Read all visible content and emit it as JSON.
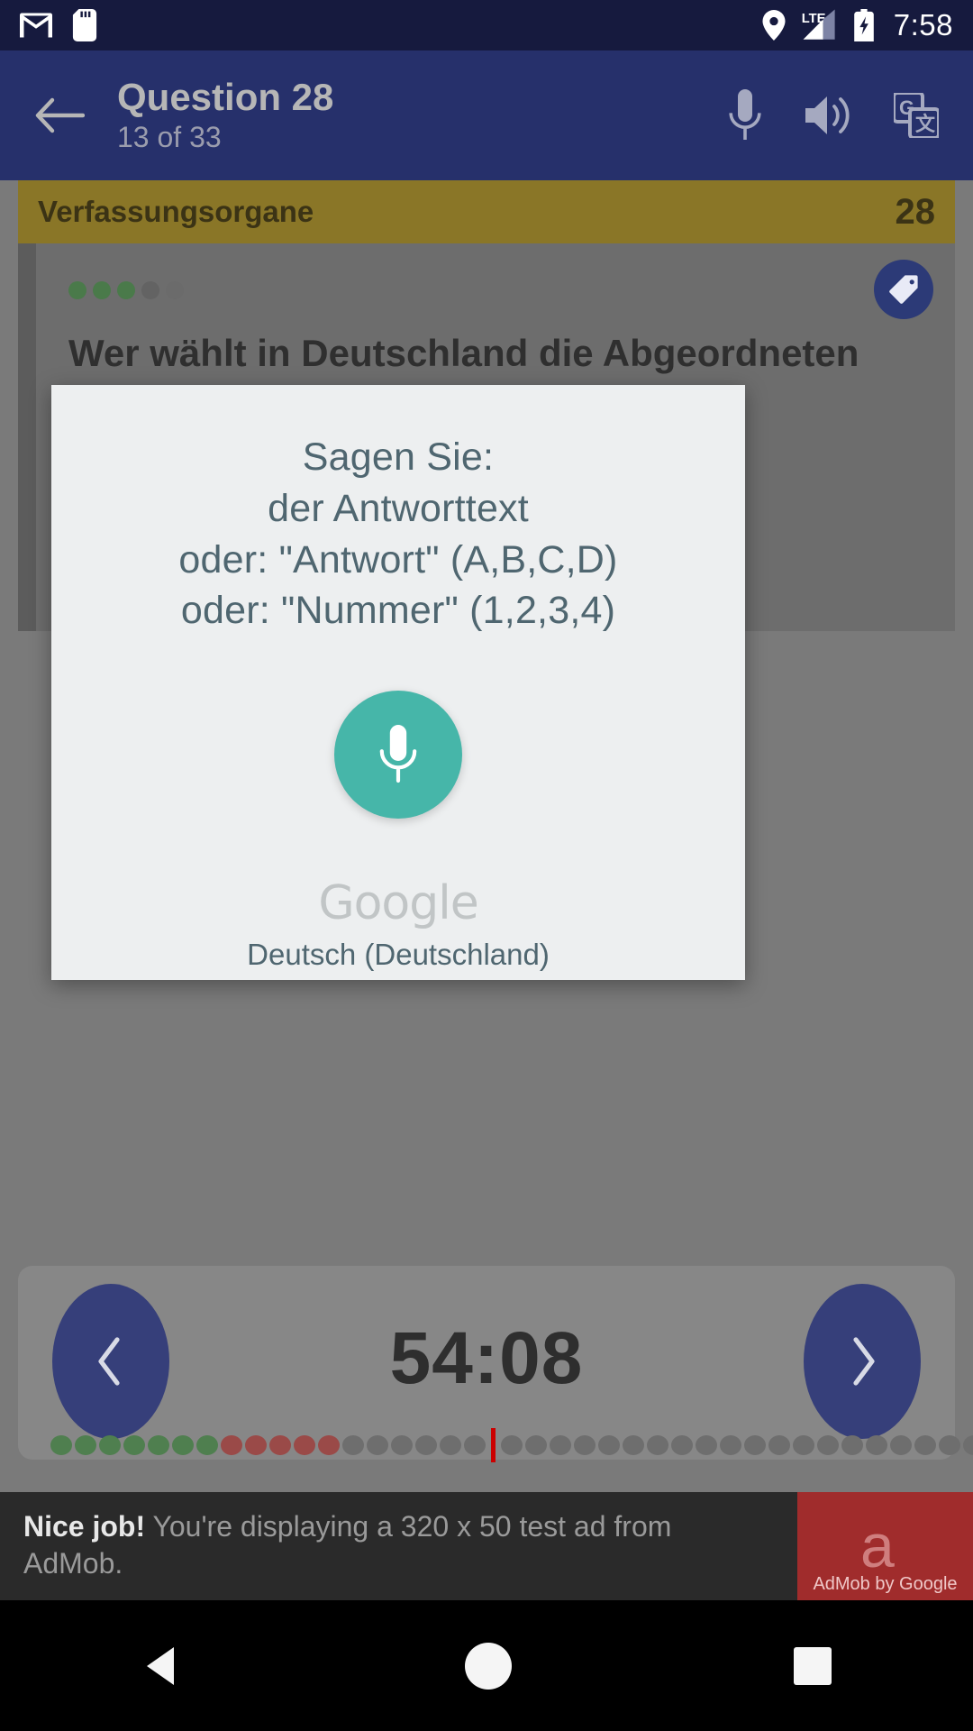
{
  "statusbar": {
    "time": "7:58",
    "icons": [
      "gmail-icon",
      "sd-card-icon",
      "location-pin-icon",
      "lte-signal-icon",
      "battery-charging-icon"
    ]
  },
  "appbar": {
    "back_icon": "back-arrow-icon",
    "title": "Question 28",
    "subtitle": "13 of 33",
    "actions": [
      "microphone-icon",
      "speaker-icon",
      "google-translate-icon"
    ]
  },
  "category": {
    "title": "Verfassungsorgane",
    "number": "28"
  },
  "question": {
    "difficulty_dots": [
      "#4a7a4a",
      "#4a7a4a",
      "#4a7a4a",
      "#636363",
      "#6b6b6b"
    ],
    "tag_icon": "tag-bookmark-icon",
    "text": "Wer wählt in Deutschland die Abgeordneten zum Bundestag?"
  },
  "dialog": {
    "lines": [
      "Sagen Sie:",
      "der Antworttext",
      "oder: \"Antwort\" (A,B,C,D)",
      "oder: \"Nummer\" (1,2,3,4)"
    ],
    "mic_icon": "microphone-icon",
    "mic_color": "#46b6a9",
    "brand": "Google",
    "language": "Deutsch (Deutschland)"
  },
  "nav": {
    "prev_icon": "chevron-left-icon",
    "next_icon": "chevron-right-icon",
    "timer": "54:08",
    "progress": {
      "green": 7,
      "red": 5,
      "gray_before_marker": 6,
      "gray_after_marker": 20,
      "green_color": "#4f7f4f",
      "red_color": "#9a4a48",
      "gray_color": "#6e6e6e",
      "marker_color": "#cc0000"
    }
  },
  "ad": {
    "headline": "Nice job!",
    "body": " You're displaying a 320 x 50 test ad from AdMob.",
    "logo_letter": "a",
    "logo_caption": "AdMob by Google",
    "logo_color": "#a02c2c"
  },
  "sysnav": {
    "back_icon": "nav-back-triangle-icon",
    "home_icon": "nav-home-circle-icon",
    "recents_icon": "nav-recents-square-icon"
  }
}
